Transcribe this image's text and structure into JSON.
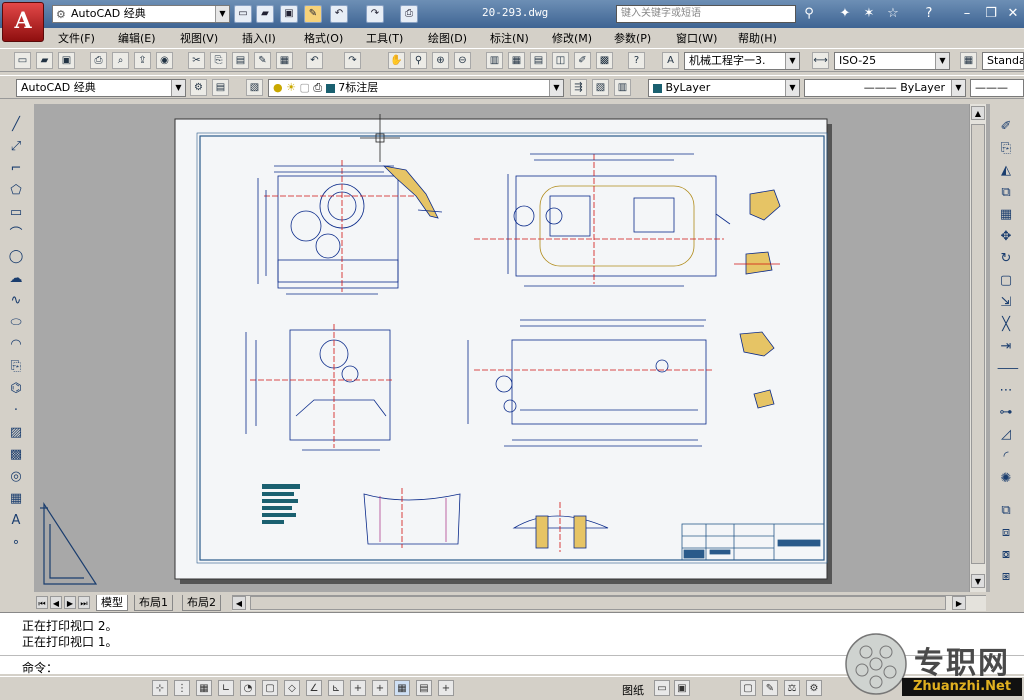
{
  "title_bar": {
    "workspace": "AutoCAD 经典",
    "document": "20-293.dwg",
    "search_placeholder": "键入关键字或短语"
  },
  "menu": [
    "文件(F)",
    "编辑(E)",
    "视图(V)",
    "插入(I)",
    "格式(O)",
    "工具(T)",
    "绘图(D)",
    "标注(N)",
    "修改(M)",
    "参数(P)",
    "窗口(W)",
    "帮助(H)"
  ],
  "toolbar_standard": {
    "text_style": "机械工程字一3.",
    "dim_style": "ISO-25",
    "table_style": "Standa"
  },
  "toolbar_layers": {
    "workspace": "AutoCAD 经典",
    "layer": "7标注层",
    "color": "ByLayer",
    "linetype": "ByLayer"
  },
  "layout_tabs": [
    "模型",
    "布局1",
    "布局2"
  ],
  "command_history": [
    "正在打印视口 2。",
    "正在打印视口 1。"
  ],
  "command_prompt": "命令：",
  "status": {
    "paper_label": "图纸"
  },
  "watermark": {
    "text": "专职网",
    "url": "Zhuanzhi.Net"
  },
  "colors": {
    "dimension": "#0a2a8a",
    "center_line": "#d01010",
    "section": "#b08a18",
    "frame": "#2a5a8a",
    "accent": "#1a6070"
  }
}
